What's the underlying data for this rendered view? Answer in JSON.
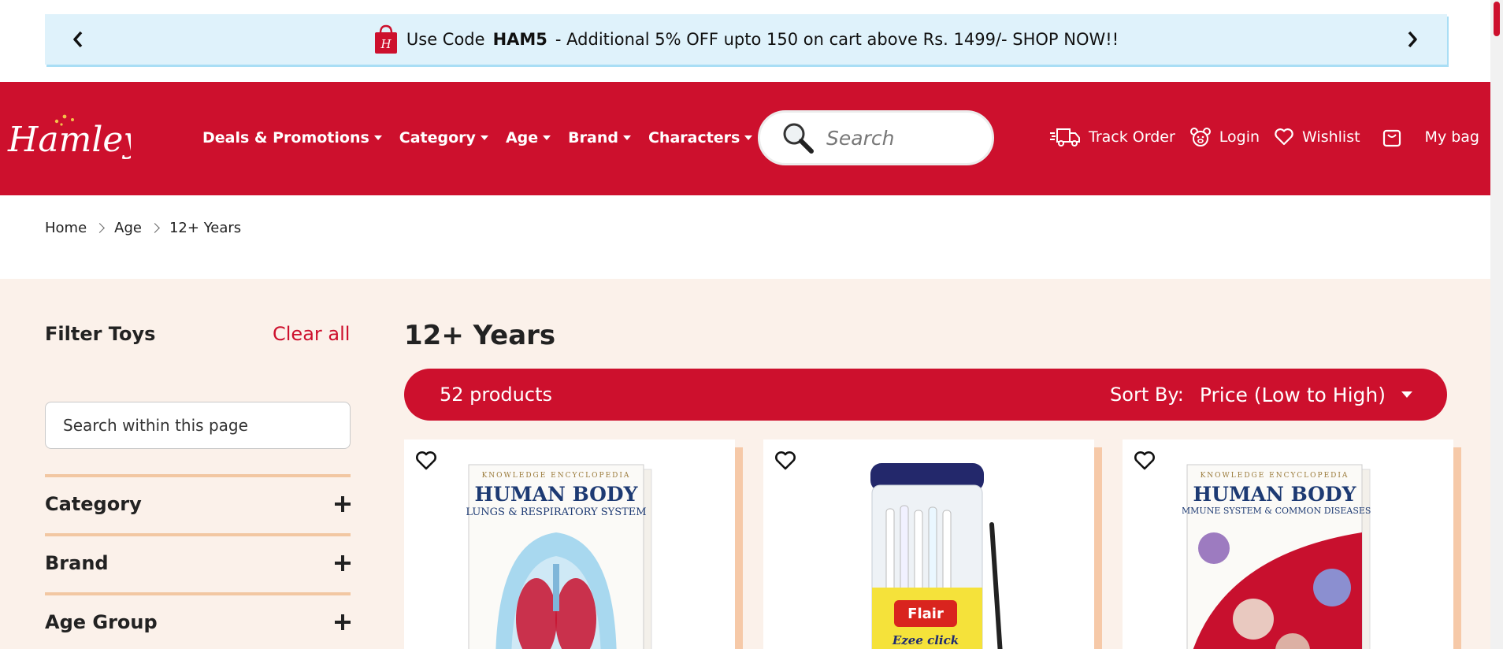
{
  "promo": {
    "text_prefix": "Use Code",
    "code": "HAM5",
    "text_suffix": "- Additional 5% OFF upto 150 on cart above Rs. 1499/- SHOP NOW!!"
  },
  "header": {
    "logo_text": "Hamleys",
    "nav": [
      {
        "label": "Deals & Promotions"
      },
      {
        "label": "Category"
      },
      {
        "label": "Age"
      },
      {
        "label": "Brand"
      },
      {
        "label": "Characters"
      }
    ],
    "search_placeholder": "Search",
    "actions": {
      "track_order": "Track Order",
      "login": "Login",
      "wishlist": "Wishlist",
      "bag": "My bag"
    }
  },
  "breadcrumb": [
    "Home",
    "Age",
    "12+ Years"
  ],
  "filters": {
    "title": "Filter Toys",
    "clear_all": "Clear all",
    "search_placeholder": "Search within this page",
    "facets": [
      "Category",
      "Brand",
      "Age Group"
    ]
  },
  "listing": {
    "title": "12+ Years",
    "product_count": "52 products",
    "sort_label": "Sort By:",
    "sort_value": "Price (Low to High)"
  },
  "products": [
    {
      "image_text_top": "KNOWLEDGE ENCYCLOPEDIA",
      "image_title": "HUMAN BODY",
      "image_subtitle": "LUNGS & RESPIRATORY SYSTEM"
    },
    {
      "image_text_top": "Flair",
      "image_title": "Ezee click",
      "image_subtitle": ""
    },
    {
      "image_text_top": "KNOWLEDGE ENCYCLOPEDIA",
      "image_title": "HUMAN BODY",
      "image_subtitle": "IMMUNE SYSTEM & COMMON DISEASES"
    }
  ],
  "colors": {
    "brand_red": "#cd102d",
    "promo_bg": "#dff2fb",
    "content_bg": "#fbf1ea",
    "divider": "#f2c7a2"
  }
}
